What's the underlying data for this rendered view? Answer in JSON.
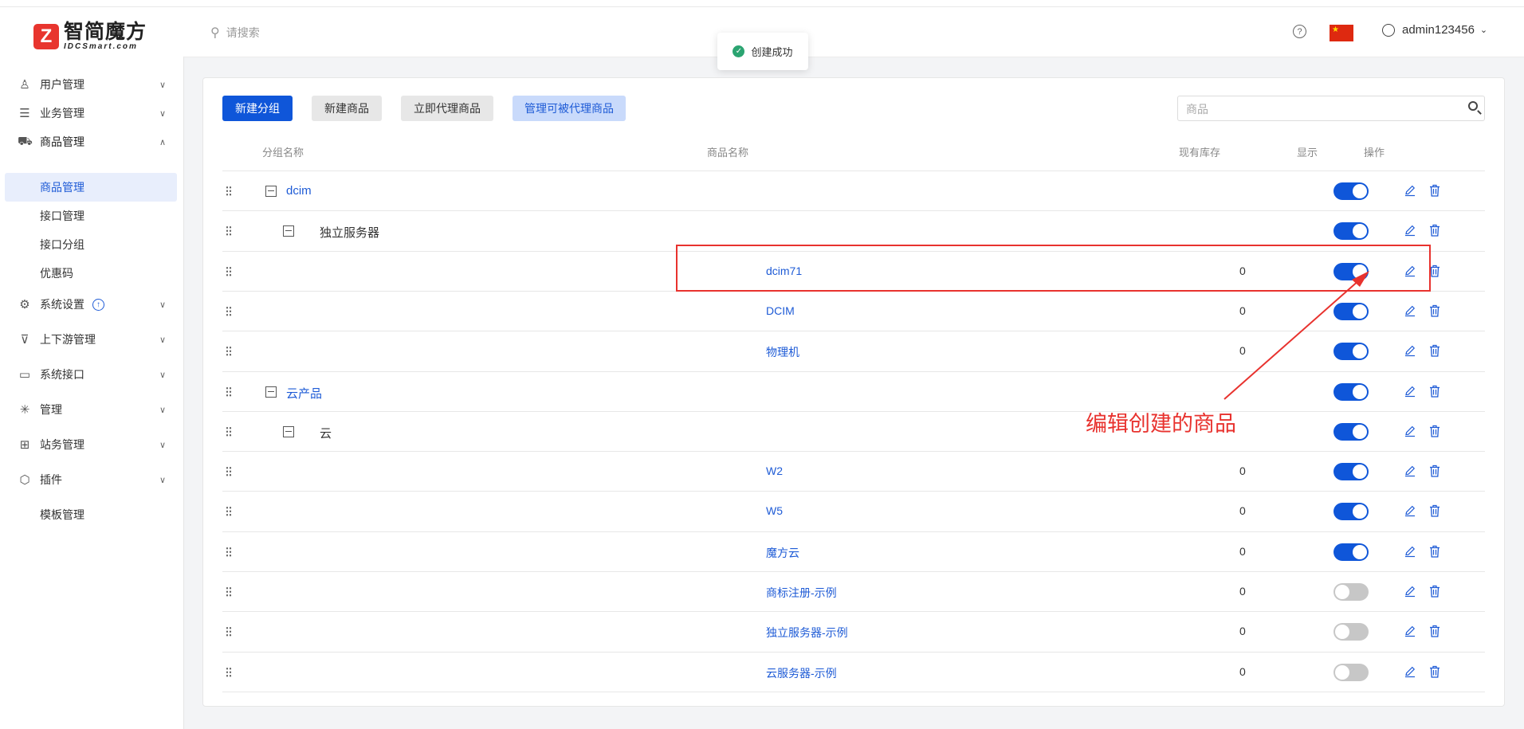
{
  "header": {
    "logo_cn": "智简魔方",
    "logo_en": "IDCSmart.com",
    "search_placeholder": "请搜索",
    "help_icon": "?",
    "username": "admin123456"
  },
  "toast": {
    "message": "创建成功"
  },
  "sidebar": {
    "items": [
      {
        "label": "用户管理",
        "icon": "user-icon"
      },
      {
        "label": "业务管理",
        "icon": "list-icon"
      },
      {
        "label": "商品管理",
        "icon": "cart-icon"
      },
      {
        "label": "系统设置",
        "icon": "gear-icon"
      },
      {
        "label": "上下游管理",
        "icon": "filter-icon"
      },
      {
        "label": "系统接口",
        "icon": "folder-icon"
      },
      {
        "label": "管理",
        "icon": "asterisk-icon"
      },
      {
        "label": "站务管理",
        "icon": "folder-plus-icon"
      },
      {
        "label": "插件",
        "icon": "cube-icon"
      },
      {
        "label": "模板管理",
        "icon": ""
      }
    ],
    "sub_items": [
      "商品管理",
      "接口管理",
      "接口分组",
      "优惠码"
    ]
  },
  "toolbar": {
    "new_group": "新建分组",
    "new_product": "新建商品",
    "proxy_now": "立即代理商品",
    "manage_proxy": "管理可被代理商品",
    "search_placeholder": "商品"
  },
  "table": {
    "headers": [
      "分组名称",
      "商品名称",
      "现有库存",
      "显示",
      "操作"
    ],
    "rows": [
      {
        "level": 1,
        "group": "dcim",
        "product": "",
        "stock": "",
        "visible": true
      },
      {
        "level": 2,
        "group": "独立服务器",
        "product": "",
        "stock": "",
        "visible": true
      },
      {
        "level": 3,
        "group": "",
        "product": "dcim71",
        "stock": "0",
        "visible": true
      },
      {
        "level": 3,
        "group": "",
        "product": "DCIM",
        "stock": "0",
        "visible": true
      },
      {
        "level": 3,
        "group": "",
        "product": "物理机",
        "stock": "0",
        "visible": true
      },
      {
        "level": 1,
        "group": "云产品",
        "product": "",
        "stock": "",
        "visible": true
      },
      {
        "level": 2,
        "group": "云",
        "product": "",
        "stock": "",
        "visible": true
      },
      {
        "level": 3,
        "group": "",
        "product": "W2",
        "stock": "0",
        "visible": true
      },
      {
        "level": 3,
        "group": "",
        "product": "W5",
        "stock": "0",
        "visible": true
      },
      {
        "level": 3,
        "group": "",
        "product": "魔方云",
        "stock": "0",
        "visible": true
      },
      {
        "level": 3,
        "group": "",
        "product": "商标注册-示例",
        "stock": "0",
        "visible": false
      },
      {
        "level": 3,
        "group": "",
        "product": "独立服务器-示例",
        "stock": "0",
        "visible": false
      },
      {
        "level": 3,
        "group": "",
        "product": "云服务器-示例",
        "stock": "0",
        "visible": false
      }
    ]
  },
  "annotation": {
    "text": "编辑创建的商品"
  },
  "colors": {
    "primary": "#0f56d9",
    "annotation_red": "#e8322e",
    "success": "#2ba471"
  }
}
